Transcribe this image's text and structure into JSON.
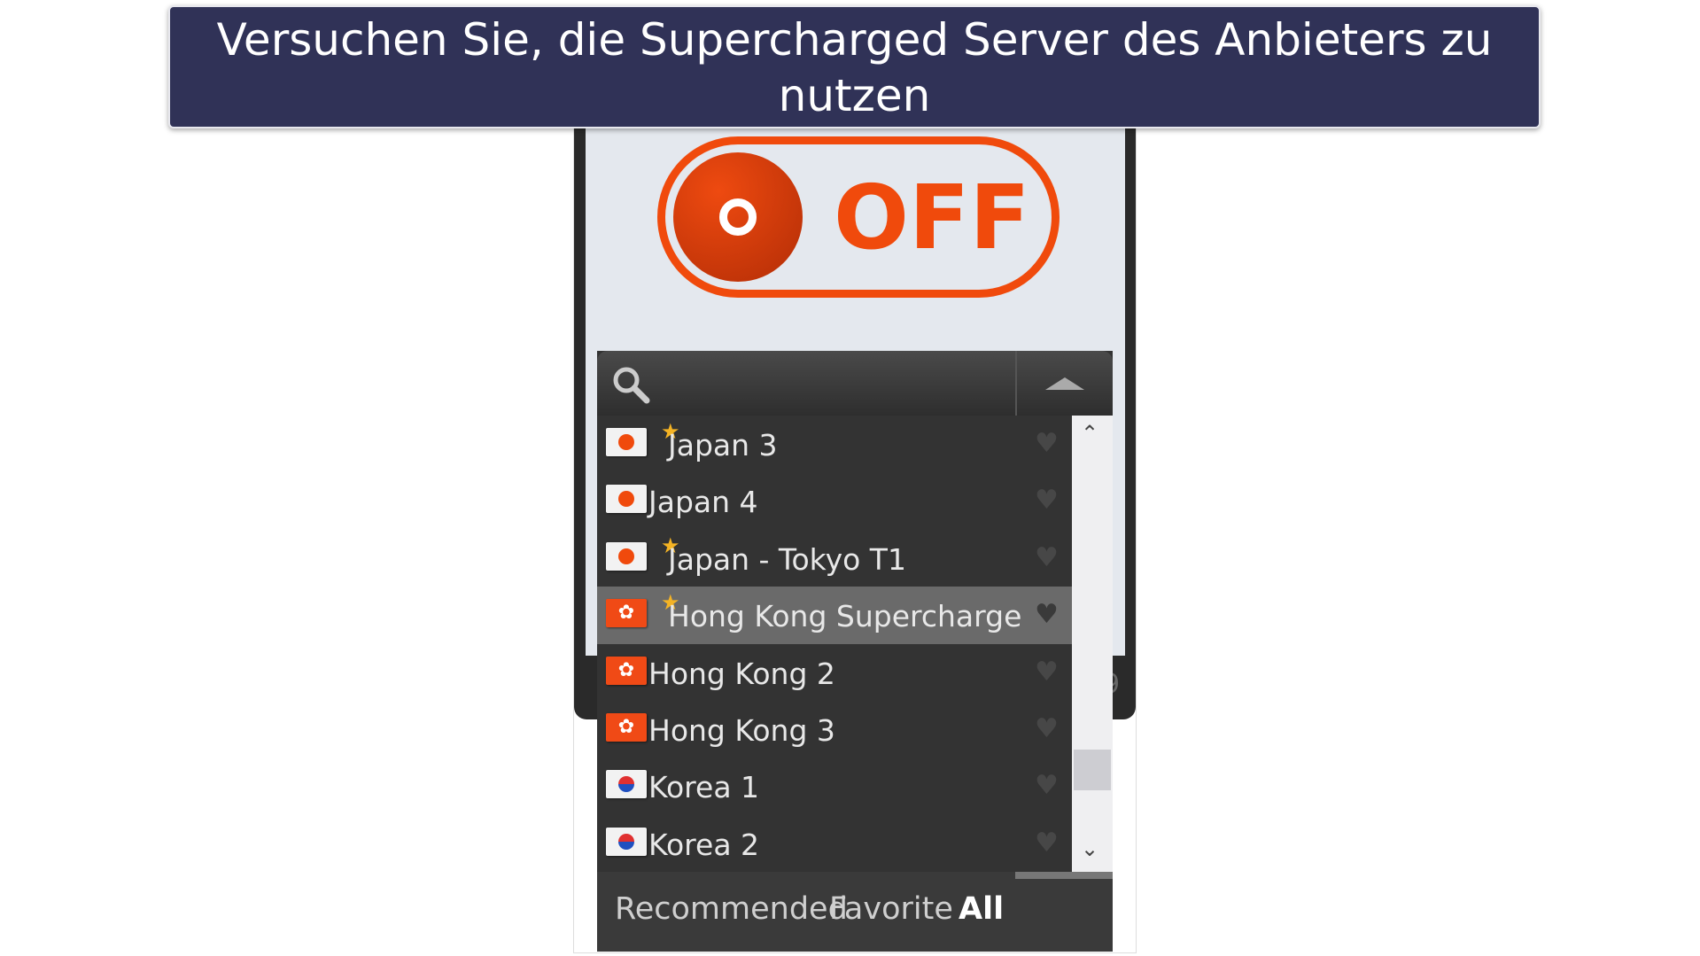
{
  "banner": {
    "text": "Versuchen Sie, die Supercharged Server des Anbieters zu nutzen"
  },
  "toggle": {
    "label": "OFF",
    "state": "off",
    "color": "#f04a0c"
  },
  "background_fragment": "9",
  "servers": [
    {
      "name": "Japan 3",
      "flag": "japan",
      "starred": true,
      "selected": false
    },
    {
      "name": "Japan 4",
      "flag": "japan",
      "starred": false,
      "selected": false
    },
    {
      "name": "Japan - Tokyo T1",
      "flag": "japan",
      "starred": true,
      "selected": false
    },
    {
      "name": "Hong Kong Supercharge",
      "flag": "hong-kong",
      "starred": true,
      "selected": true
    },
    {
      "name": "Hong Kong 2",
      "flag": "hong-kong",
      "starred": false,
      "selected": false
    },
    {
      "name": "Hong Kong 3",
      "flag": "hong-kong",
      "starred": false,
      "selected": false
    },
    {
      "name": "Korea 1",
      "flag": "korea",
      "starred": false,
      "selected": false
    },
    {
      "name": "Korea 2",
      "flag": "korea",
      "starred": false,
      "selected": false
    }
  ],
  "tabs": [
    {
      "label": "Recommended",
      "active": false
    },
    {
      "label": "Favorite",
      "active": false
    },
    {
      "label": "All",
      "active": true
    }
  ]
}
